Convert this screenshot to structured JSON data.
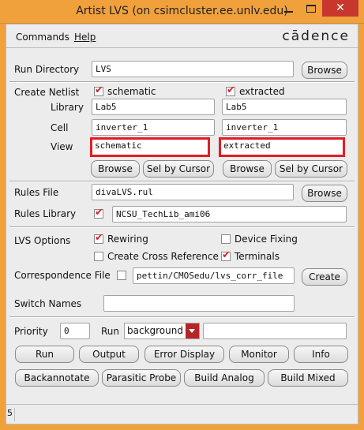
{
  "window": {
    "title": "Artist LVS (on csimcluster.ee.unlv.edu)",
    "close_glyph": "✕"
  },
  "menu": {
    "commands": "Commands",
    "help": "Help",
    "logo": "cādence"
  },
  "run_directory": {
    "label": "Run Directory",
    "value": "LVS",
    "browse": "Browse"
  },
  "create_netlist": {
    "label": "Create Netlist",
    "library_label": "Library",
    "cell_label": "Cell",
    "view_label": "View",
    "schematic": {
      "checkbox_label": "schematic",
      "checked": true,
      "library": "Lab5",
      "cell": "inverter_1",
      "view": "schematic",
      "browse": "Browse",
      "sel_by_cursor": "Sel by Cursor"
    },
    "extracted": {
      "checkbox_label": "extracted",
      "checked": true,
      "library": "Lab5",
      "cell": "inverter_1",
      "view": "extracted",
      "browse": "Browse",
      "sel_by_cursor": "Sel by Cursor"
    }
  },
  "rules_file": {
    "label": "Rules File",
    "value": "divaLVS.rul",
    "browse": "Browse"
  },
  "rules_library": {
    "label": "Rules Library",
    "checked": true,
    "value": "NCSU_TechLib_ami06"
  },
  "lvs_options": {
    "label": "LVS Options",
    "rewiring": {
      "label": "Rewiring",
      "checked": true
    },
    "device_fixing": {
      "label": "Device Fixing",
      "checked": false
    },
    "create_cross_reference": {
      "label": "Create Cross Reference",
      "checked": false
    },
    "terminals": {
      "label": "Terminals",
      "checked": true
    }
  },
  "correspondence_file": {
    "label": "Correspondence File",
    "checked": false,
    "value": "pettin/CMOSedu/lvs_corr_file",
    "create": "Create"
  },
  "switch_names": {
    "label": "Switch Names",
    "value": ""
  },
  "priority": {
    "label": "Priority",
    "value": "0"
  },
  "run_mode": {
    "label": "Run",
    "selected": "background",
    "extra": ""
  },
  "buttons": {
    "run": "Run",
    "output": "Output",
    "error_display": "Error Display",
    "monitor": "Monitor",
    "info": "Info",
    "backannotate": "Backannotate",
    "parasitic_probe": "Parasitic Probe",
    "build_analog": "Build Analog",
    "build_mixed": "Build Mixed"
  },
  "status": {
    "number": "5",
    "text": ""
  }
}
